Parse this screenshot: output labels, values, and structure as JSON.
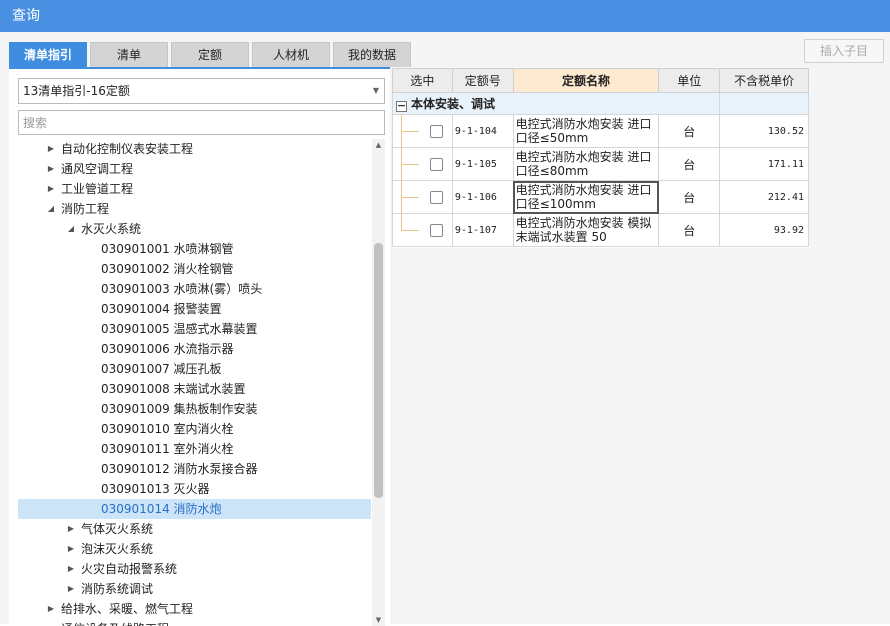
{
  "window": {
    "title": "查询"
  },
  "tabs": [
    {
      "label": "清单指引",
      "active": true
    },
    {
      "label": "清单",
      "active": false
    },
    {
      "label": "定额",
      "active": false
    },
    {
      "label": "人材机",
      "active": false
    },
    {
      "label": "我的数据",
      "active": false
    }
  ],
  "toolbar": {
    "insert_child_label": "插入子目"
  },
  "left": {
    "dropdown_value": "13清单指引-16定额",
    "search_placeholder": "搜索",
    "tree": [
      {
        "label": "自动化控制仪表安装工程",
        "level": 1,
        "arrow": "right"
      },
      {
        "label": "通风空调工程",
        "level": 1,
        "arrow": "right"
      },
      {
        "label": "工业管道工程",
        "level": 1,
        "arrow": "right"
      },
      {
        "label": "消防工程",
        "level": 1,
        "arrow": "down"
      },
      {
        "label": "水灭火系统",
        "level": 2,
        "arrow": "down"
      },
      {
        "label": "030901001  水喷淋钢管",
        "level": 3
      },
      {
        "label": "030901002  消火栓钢管",
        "level": 3
      },
      {
        "label": "030901003  水喷淋(雾）喷头",
        "level": 3
      },
      {
        "label": "030901004  报警装置",
        "level": 3
      },
      {
        "label": "030901005  温感式水幕装置",
        "level": 3
      },
      {
        "label": "030901006  水流指示器",
        "level": 3
      },
      {
        "label": "030901007  减压孔板",
        "level": 3
      },
      {
        "label": "030901008  末端试水装置",
        "level": 3
      },
      {
        "label": "030901009  集热板制作安装",
        "level": 3
      },
      {
        "label": "030901010  室内消火栓",
        "level": 3
      },
      {
        "label": "030901011  室外消火栓",
        "level": 3
      },
      {
        "label": "030901012  消防水泵接合器",
        "level": 3
      },
      {
        "label": "030901013  灭火器",
        "level": 3
      },
      {
        "label": "030901014  消防水炮",
        "level": 3,
        "selected": true
      },
      {
        "label": "气体灭火系统",
        "level": 2,
        "arrow": "right"
      },
      {
        "label": "泡沫灭火系统",
        "level": 2,
        "arrow": "right"
      },
      {
        "label": "火灾自动报警系统",
        "level": 2,
        "arrow": "right"
      },
      {
        "label": "消防系统调试",
        "level": 2,
        "arrow": "right"
      },
      {
        "label": "给排水、采暖、燃气工程",
        "level": 1,
        "arrow": "right"
      },
      {
        "label": "通信设备及线路工程",
        "level": 1,
        "arrow": "right"
      }
    ]
  },
  "grid": {
    "columns": [
      "选中",
      "定额号",
      "定额名称",
      "单位",
      "不含税单价"
    ],
    "group_label": "本体安装、调试",
    "group_toggle": "−",
    "rows": [
      {
        "code": "9-1-104",
        "name": "电控式消防水炮安装 进口口径≤50mm",
        "unit": "台",
        "price": "130.52"
      },
      {
        "code": "9-1-105",
        "name": "电控式消防水炮安装 进口口径≤80mm",
        "unit": "台",
        "price": "171.11"
      },
      {
        "code": "9-1-106",
        "name": "电控式消防水炮安装 进口口径≤100mm",
        "unit": "台",
        "price": "212.41",
        "focused": true
      },
      {
        "code": "9-1-107",
        "name": "电控式消防水炮安装 模拟末端试水装置 50",
        "unit": "台",
        "price": "93.92"
      }
    ]
  }
}
